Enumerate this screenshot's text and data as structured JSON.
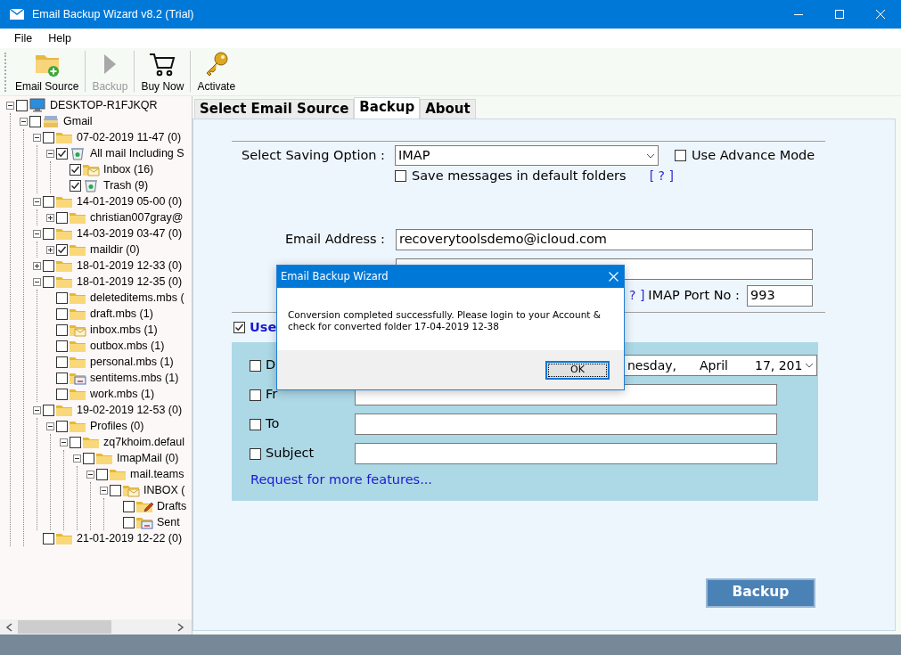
{
  "window": {
    "title": "Email Backup Wizard v8.2 (Trial)"
  },
  "menu": [
    "File",
    "Help"
  ],
  "toolbar": [
    {
      "label": "Email Source",
      "kind": "source",
      "disabled": false
    },
    {
      "label": "Backup",
      "kind": "run",
      "disabled": true
    },
    {
      "label": "Buy Now",
      "kind": "buy",
      "disabled": false
    },
    {
      "label": "Activate",
      "kind": "activate",
      "disabled": false
    }
  ],
  "tree": [
    {
      "label": "DESKTOP-R1FJKQR",
      "kind": "computer",
      "checked": false,
      "expanded": true,
      "children": [
        {
          "label": "Gmail",
          "kind": "stack",
          "checked": false,
          "expanded": true,
          "children": [
            {
              "label": "07-02-2019 11-47 (0)",
              "kind": "folder",
              "checked": false,
              "expanded": true,
              "children": [
                {
                  "label": "All mail Including S",
                  "kind": "trash",
                  "checked": true,
                  "expanded": true,
                  "children": [
                    {
                      "label": "Inbox (16)",
                      "kind": "mailfolder",
                      "checked": true
                    },
                    {
                      "label": "Trash (9)",
                      "kind": "trash",
                      "checked": true
                    }
                  ]
                }
              ]
            },
            {
              "label": "14-01-2019 05-00 (0)",
              "kind": "folder",
              "checked": false,
              "expanded": true,
              "children": [
                {
                  "label": "christian007gray@",
                  "kind": "folder",
                  "checked": false,
                  "expanded": false
                }
              ]
            },
            {
              "label": "14-03-2019 03-47 (0)",
              "kind": "folder",
              "checked": false,
              "expanded": true,
              "children": [
                {
                  "label": "maildir (0)",
                  "kind": "folder",
                  "checked": true,
                  "expanded": false
                }
              ]
            },
            {
              "label": "18-01-2019 12-33 (0)",
              "kind": "folder",
              "checked": false,
              "expanded": false
            },
            {
              "label": "18-01-2019 12-35 (0)",
              "kind": "folder",
              "checked": false,
              "expanded": true,
              "children": [
                {
                  "label": "deleteditems.mbs (",
                  "kind": "folder",
                  "checked": false
                },
                {
                  "label": "draft.mbs (1)",
                  "kind": "folder",
                  "checked": false
                },
                {
                  "label": "inbox.mbs (1)",
                  "kind": "mailfolder",
                  "checked": false
                },
                {
                  "label": "outbox.mbs (1)",
                  "kind": "folder",
                  "checked": false
                },
                {
                  "label": "personal.mbs (1)",
                  "kind": "folder",
                  "checked": false
                },
                {
                  "label": "sentitems.mbs (1)",
                  "kind": "sent",
                  "checked": false
                },
                {
                  "label": "work.mbs (1)",
                  "kind": "folder",
                  "checked": false
                }
              ]
            },
            {
              "label": "19-02-2019 12-53 (0)",
              "kind": "folder",
              "checked": false,
              "expanded": true,
              "children": [
                {
                  "label": "Profiles (0)",
                  "kind": "folder",
                  "checked": false,
                  "expanded": true,
                  "children": [
                    {
                      "label": "zq7khoim.defaul",
                      "kind": "folder",
                      "checked": false,
                      "expanded": true,
                      "children": [
                        {
                          "label": "ImapMail (0)",
                          "kind": "folder",
                          "checked": false,
                          "expanded": true,
                          "children": [
                            {
                              "label": "mail.teams",
                              "kind": "folder",
                              "checked": false,
                              "expanded": true,
                              "children": [
                                {
                                  "label": "INBOX (",
                                  "kind": "mailfolder",
                                  "checked": false,
                                  "expanded": true,
                                  "children": [
                                    {
                                      "label": "Drafts",
                                      "kind": "drafts",
                                      "checked": false
                                    },
                                    {
                                      "label": "Sent",
                                      "kind": "sent",
                                      "checked": false
                                    }
                                  ]
                                }
                              ]
                            }
                          ]
                        }
                      ]
                    }
                  ]
                }
              ]
            },
            {
              "label": "21-01-2019 12-22 (0)",
              "kind": "folder",
              "checked": false
            }
          ]
        }
      ]
    }
  ],
  "tabs": [
    {
      "label": "Select Email Source",
      "selected": false
    },
    {
      "label": "Backup",
      "selected": true
    },
    {
      "label": "About",
      "selected": false
    }
  ],
  "form": {
    "saving_option": {
      "label": "Select Saving Option :",
      "value": "IMAP"
    },
    "advance_mode": {
      "label": "Use Advance Mode",
      "checked": false
    },
    "default_folders": {
      "label": "Save messages in default folders",
      "checked": false,
      "help": "[ ? ]"
    },
    "email": {
      "label": "Email Address :",
      "value": "recoverytoolsdemo@icloud.com"
    },
    "port_help": "? ]",
    "port": {
      "label": "IMAP Port No :",
      "value": "993"
    },
    "filter": {
      "label": "Use",
      "checked": true
    },
    "filters": [
      {
        "kind": "date",
        "label": "D",
        "checked": false,
        "parts": [
          "nesday,",
          "April",
          "17, 201"
        ]
      },
      {
        "kind": "text",
        "label": "Fr",
        "checked": false
      },
      {
        "kind": "text",
        "label": "To",
        "checked": false
      },
      {
        "kind": "text",
        "label": "Subject",
        "checked": false
      }
    ],
    "more_link": "Request for more features...",
    "backup_button": "Backup"
  },
  "dialog": {
    "title": "Email Backup Wizard",
    "message": "Conversion completed successfully. Please login to your Account & check for converted folder 17-04-2019 12-38",
    "ok": "OK"
  }
}
